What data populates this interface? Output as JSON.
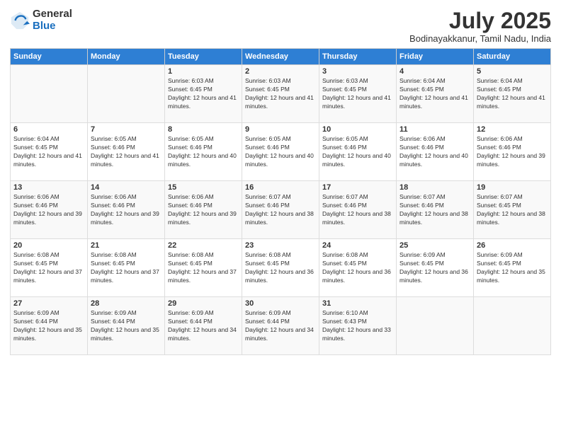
{
  "logo": {
    "general": "General",
    "blue": "Blue"
  },
  "title": "July 2025",
  "subtitle": "Bodinayakkanur, Tamil Nadu, India",
  "days_header": [
    "Sunday",
    "Monday",
    "Tuesday",
    "Wednesday",
    "Thursday",
    "Friday",
    "Saturday"
  ],
  "weeks": [
    [
      {
        "day": "",
        "info": ""
      },
      {
        "day": "",
        "info": ""
      },
      {
        "day": "1",
        "info": "Sunrise: 6:03 AM\nSunset: 6:45 PM\nDaylight: 12 hours and 41 minutes."
      },
      {
        "day": "2",
        "info": "Sunrise: 6:03 AM\nSunset: 6:45 PM\nDaylight: 12 hours and 41 minutes."
      },
      {
        "day": "3",
        "info": "Sunrise: 6:03 AM\nSunset: 6:45 PM\nDaylight: 12 hours and 41 minutes."
      },
      {
        "day": "4",
        "info": "Sunrise: 6:04 AM\nSunset: 6:45 PM\nDaylight: 12 hours and 41 minutes."
      },
      {
        "day": "5",
        "info": "Sunrise: 6:04 AM\nSunset: 6:45 PM\nDaylight: 12 hours and 41 minutes."
      }
    ],
    [
      {
        "day": "6",
        "info": "Sunrise: 6:04 AM\nSunset: 6:45 PM\nDaylight: 12 hours and 41 minutes."
      },
      {
        "day": "7",
        "info": "Sunrise: 6:05 AM\nSunset: 6:46 PM\nDaylight: 12 hours and 41 minutes."
      },
      {
        "day": "8",
        "info": "Sunrise: 6:05 AM\nSunset: 6:46 PM\nDaylight: 12 hours and 40 minutes."
      },
      {
        "day": "9",
        "info": "Sunrise: 6:05 AM\nSunset: 6:46 PM\nDaylight: 12 hours and 40 minutes."
      },
      {
        "day": "10",
        "info": "Sunrise: 6:05 AM\nSunset: 6:46 PM\nDaylight: 12 hours and 40 minutes."
      },
      {
        "day": "11",
        "info": "Sunrise: 6:06 AM\nSunset: 6:46 PM\nDaylight: 12 hours and 40 minutes."
      },
      {
        "day": "12",
        "info": "Sunrise: 6:06 AM\nSunset: 6:46 PM\nDaylight: 12 hours and 39 minutes."
      }
    ],
    [
      {
        "day": "13",
        "info": "Sunrise: 6:06 AM\nSunset: 6:46 PM\nDaylight: 12 hours and 39 minutes."
      },
      {
        "day": "14",
        "info": "Sunrise: 6:06 AM\nSunset: 6:46 PM\nDaylight: 12 hours and 39 minutes."
      },
      {
        "day": "15",
        "info": "Sunrise: 6:06 AM\nSunset: 6:46 PM\nDaylight: 12 hours and 39 minutes."
      },
      {
        "day": "16",
        "info": "Sunrise: 6:07 AM\nSunset: 6:46 PM\nDaylight: 12 hours and 38 minutes."
      },
      {
        "day": "17",
        "info": "Sunrise: 6:07 AM\nSunset: 6:46 PM\nDaylight: 12 hours and 38 minutes."
      },
      {
        "day": "18",
        "info": "Sunrise: 6:07 AM\nSunset: 6:46 PM\nDaylight: 12 hours and 38 minutes."
      },
      {
        "day": "19",
        "info": "Sunrise: 6:07 AM\nSunset: 6:45 PM\nDaylight: 12 hours and 38 minutes."
      }
    ],
    [
      {
        "day": "20",
        "info": "Sunrise: 6:08 AM\nSunset: 6:45 PM\nDaylight: 12 hours and 37 minutes."
      },
      {
        "day": "21",
        "info": "Sunrise: 6:08 AM\nSunset: 6:45 PM\nDaylight: 12 hours and 37 minutes."
      },
      {
        "day": "22",
        "info": "Sunrise: 6:08 AM\nSunset: 6:45 PM\nDaylight: 12 hours and 37 minutes."
      },
      {
        "day": "23",
        "info": "Sunrise: 6:08 AM\nSunset: 6:45 PM\nDaylight: 12 hours and 36 minutes."
      },
      {
        "day": "24",
        "info": "Sunrise: 6:08 AM\nSunset: 6:45 PM\nDaylight: 12 hours and 36 minutes."
      },
      {
        "day": "25",
        "info": "Sunrise: 6:09 AM\nSunset: 6:45 PM\nDaylight: 12 hours and 36 minutes."
      },
      {
        "day": "26",
        "info": "Sunrise: 6:09 AM\nSunset: 6:45 PM\nDaylight: 12 hours and 35 minutes."
      }
    ],
    [
      {
        "day": "27",
        "info": "Sunrise: 6:09 AM\nSunset: 6:44 PM\nDaylight: 12 hours and 35 minutes."
      },
      {
        "day": "28",
        "info": "Sunrise: 6:09 AM\nSunset: 6:44 PM\nDaylight: 12 hours and 35 minutes."
      },
      {
        "day": "29",
        "info": "Sunrise: 6:09 AM\nSunset: 6:44 PM\nDaylight: 12 hours and 34 minutes."
      },
      {
        "day": "30",
        "info": "Sunrise: 6:09 AM\nSunset: 6:44 PM\nDaylight: 12 hours and 34 minutes."
      },
      {
        "day": "31",
        "info": "Sunrise: 6:10 AM\nSunset: 6:43 PM\nDaylight: 12 hours and 33 minutes."
      },
      {
        "day": "",
        "info": ""
      },
      {
        "day": "",
        "info": ""
      }
    ]
  ]
}
